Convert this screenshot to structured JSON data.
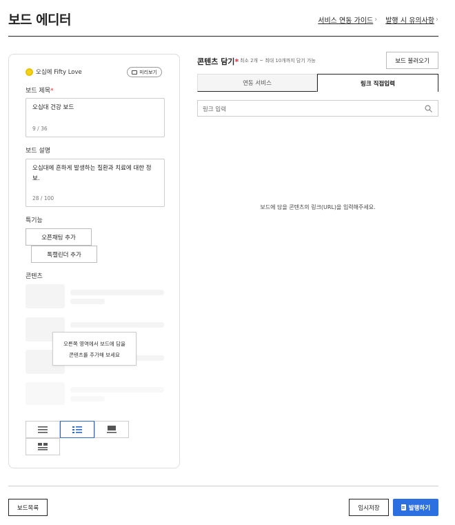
{
  "page": {
    "title": "보드 에디터"
  },
  "top_links": [
    {
      "label": "서비스 연동 가이드"
    },
    {
      "label": "발행 시 유의사항"
    }
  ],
  "editor": {
    "brand_name": "오십에 Fifty Love",
    "preview_label": "미리보기",
    "title_field": {
      "label": "보드 제목",
      "value": "오십대 건강 보드",
      "count": "9 / 36"
    },
    "desc_field": {
      "label": "보드 설명",
      "value": "오십대에 흔하게 발생하는 질환과 치료에 대한 정보.",
      "count": "28 / 100"
    },
    "features": {
      "label": "특기능",
      "open_chat": "오픈채팅 추가",
      "calendar": "톡캘린더 추가"
    },
    "contents": {
      "label": "콘텐츠",
      "tooltip_line1": "오른쪽 영역에서 보드에 담을",
      "tooltip_line2": "콘텐츠를 추가해 보세요"
    },
    "layout_selected": "list-thumbnail"
  },
  "content_panel": {
    "title": "콘텐츠 담기",
    "subtitle": "최소 2개 ~ 최대 10개까지 담기 가능",
    "load_button": "보드 불러오기",
    "tabs": [
      {
        "label": "연동 서비스",
        "active": false
      },
      {
        "label": "링크 직접입력",
        "active": true
      }
    ],
    "search_placeholder": "링크 입력",
    "empty_message": "보드에 담을 콘텐츠의 링크(URL)을 입력해주세요."
  },
  "footer": {
    "list_button": "보드목록",
    "save_button": "임시저장",
    "publish_button": "발행하기"
  },
  "colors": {
    "accent": "#2b6fe0",
    "required": "#e23333",
    "brand": "#f5d21a"
  }
}
